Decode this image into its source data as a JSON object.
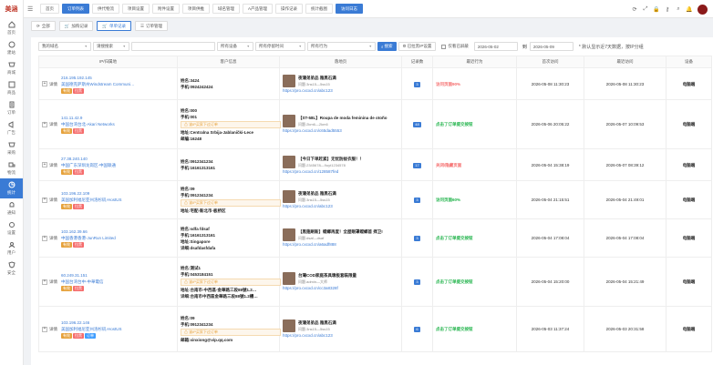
{
  "app": {
    "logo_text": "美涵",
    "colors": {
      "primary": "#3a7bd5",
      "red": "#f56c6c",
      "green": "#20b34a",
      "orange": "#e6a23c"
    }
  },
  "sidebar": {
    "items": [
      {
        "label": "首页",
        "icon": "home-icon"
      },
      {
        "label": "建站",
        "icon": "site-icon"
      },
      {
        "label": "商城",
        "icon": "shop-icon"
      },
      {
        "label": "商品",
        "icon": "product-icon"
      },
      {
        "label": "订单",
        "icon": "order-icon"
      },
      {
        "label": "广告",
        "icon": "ad-icon"
      },
      {
        "label": "采购",
        "icon": "purchase-icon"
      },
      {
        "label": "物流",
        "icon": "truck-icon"
      },
      {
        "label": "统计",
        "icon": "chart-icon"
      },
      {
        "label": "通知",
        "icon": "bell-icon"
      },
      {
        "label": "设置",
        "icon": "gear-icon"
      },
      {
        "label": "用户",
        "icon": "user-icon"
      },
      {
        "label": "安全",
        "icon": "shield-icon"
      }
    ]
  },
  "tabs": [
    "首页",
    "订单列表",
    "供代物流",
    "项目设置",
    "附件设置",
    "项目供推",
    "域名管理",
    "A产品管理",
    "操作记录",
    "统计截图",
    "访问日志"
  ],
  "toolbar": {
    "all": "全部",
    "add": "加购记录",
    "single": "单单记录",
    "order_mgmt": "订单管理"
  },
  "filters": {
    "domain": "我的域名",
    "keyword": "请搜搜索",
    "device": "所有设备",
    "stay": "所有停留时间",
    "behavior": "所有行为",
    "search": "搜索",
    "blacklist": "已拉黑IP设置",
    "only_blocked": "仅看已屏蔽",
    "date_from": "2026-05-02",
    "to": "到",
    "date_to": "2026-05-09",
    "note": "* 默认显示近7天数据，按IP分组"
  },
  "columns": [
    "IP/归属地",
    "客户信息",
    "落地页",
    "记录数",
    "最近行为",
    "首次访问",
    "最近访问",
    "设备"
  ],
  "rows": [
    {
      "ip": "216.195.192.145",
      "loc": "美国德克萨斯州Windstream Communi…",
      "tags": [
        "有效",
        "拉黑"
      ],
      "name": "姓名:3424",
      "phone": "手机:0924242424",
      "warn": "",
      "addr": "",
      "extra": "",
      "page_title": "夜蒲弟弟品 雅黑石满",
      "page_sub": "问题:3ns15—5ss15",
      "page_url": "https://pro.cxcxd.cn/abc123",
      "count": "3",
      "action": "访问页面90%",
      "action_color": "#f56c6c",
      "first": "2026-05-08 11:30:23",
      "last": "2026-05-08 11:30:23",
      "device": "电脑端"
    },
    {
      "ip": "141.11.42.9",
      "loc": "中国台湾台北-Akari Networks",
      "tags": [
        "有效",
        "拉黑"
      ],
      "name": "姓名:000",
      "phone": "手机:001",
      "warn": "该IP买家下过订单",
      "addr": "地址:Centralna Srbija-Jablanički-Lece",
      "extra": "邮编:16248",
      "page_title": "【ST-58L】Roupa de moda feminina de otoño",
      "page_sub": "问题:2km6—2km6",
      "page_url": "https://pro.cxcxd.cn/c65dad5553",
      "count": "48",
      "action": "点击了订单提交按钮",
      "action_color": "#20b34a",
      "first": "2026-05-06 20:05:22",
      "last": "2026-05-07 10:09:53",
      "device": "电脑端"
    },
    {
      "ip": "27.38.240.140",
      "loc": "中国广东深圳龙岗区-中国联通",
      "tags": [
        "有效",
        "拉黑"
      ],
      "name": "姓名:0912341234",
      "phone": "手机:16161313161",
      "warn": "",
      "addr": "",
      "extra": "",
      "page_title": "【今日下单赶紧】无忧防蚊衣服！！",
      "page_sub": "问题:2345678—9uyt1234578",
      "page_url": "https://pro.cxcxd.cn/128587fed",
      "count": "17",
      "action": "关闭/隐藏页面",
      "action_color": "#f56c6c",
      "first": "2026-05-04 15:38:19",
      "last": "2026-05-07 08:39:12",
      "device": "电脑端"
    },
    {
      "ip": "103.196.22.109",
      "loc": "美国加利福尼亚州洛杉矶-HostUS",
      "tags": [
        "有效",
        "拉黑"
      ],
      "name": "姓名:09",
      "phone": "手机:0912341234",
      "warn": "该IP买家下过订单",
      "addr": "地址:宅配-新北市-板桥区",
      "extra": "",
      "page_title": "夜蒲弟弟品 雅黑石满",
      "page_sub": "问题:3ns15—5ss15",
      "page_url": "https://pro.cxcxd.cn/abc123",
      "count": "3",
      "action": "访问页面60%",
      "action_color": "#20b34a",
      "first": "2026-05-04 21:15:51",
      "last": "2026-05-04 21:49:01",
      "device": "电脑端"
    },
    {
      "ip": "103.162.39.66",
      "loc": "中国香港香港-JunRun Limited",
      "tags": [
        "有效",
        "拉黑"
      ],
      "name": "姓名:sdfa fdsaf",
      "phone": "手机:16161313161",
      "warn": "",
      "addr": "地址:Singapore",
      "extra": "详细:dsafdasfdafa",
      "page_title": "【黑翅刷新】螳螂再度！全屋眼罩螳螂首 捍卫!",
      "page_sub": "问题:dsaf—dsaf",
      "page_url": "https://pro.cxcxd.cn/a6adf888",
      "count": "3",
      "action": "点击了订单提交按钮",
      "action_color": "#20b34a",
      "first": "2026-05-04 17:08:04",
      "last": "2026-05-04 17:08:04",
      "device": "电脑端"
    },
    {
      "ip": "60.249.31.151",
      "loc": "中国台湾台中-中華電信",
      "tags": [
        "有效",
        "拉黑"
      ],
      "name": "姓名:测试1",
      "phone": "手机:0453184151",
      "warn": "该IP买家下过订单",
      "addr": "地址:台南市-中西區-金華路三段88號1.2…",
      "extra": "详细:台南市中西區金華路三段88號1.2樓…",
      "page_title": "台灣COD家庭茶具墩板套裝限量",
      "page_sub": "问题:admin—大师",
      "page_url": "https://pro.cxcxd.cn/cc3a8328f",
      "count": "3",
      "action": "点击了订单提交按钮",
      "action_color": "#20b34a",
      "first": "2026-05-04 15:20:00",
      "last": "2026-05-04 15:21:49",
      "device": "电脑端"
    },
    {
      "ip": "103.196.22.146",
      "loc": "美国加利福尼亚州洛杉矶-HostUS",
      "tags": [
        "有效",
        "拉黑",
        "订单"
      ],
      "name": "姓名:09",
      "phone": "手机:0912341234",
      "warn": "该IP买家下过订单",
      "addr": "邮箱:xinxiong@vip.qq.com",
      "extra": "",
      "page_title": "夜蒲弟弟品 雅黑石满",
      "page_sub": "问题:3ns15—5ss15",
      "page_url": "https://pro.cxcxd.cn/abc123",
      "count": "6",
      "action": "点击了订单提交按钮",
      "action_color": "#20b34a",
      "first": "2026-05-03 11:37:24",
      "last": "2026-05-03 20:31:58",
      "device": "电脑端"
    }
  ],
  "row_labels": {
    "expand": "+",
    "detail": "详情"
  }
}
